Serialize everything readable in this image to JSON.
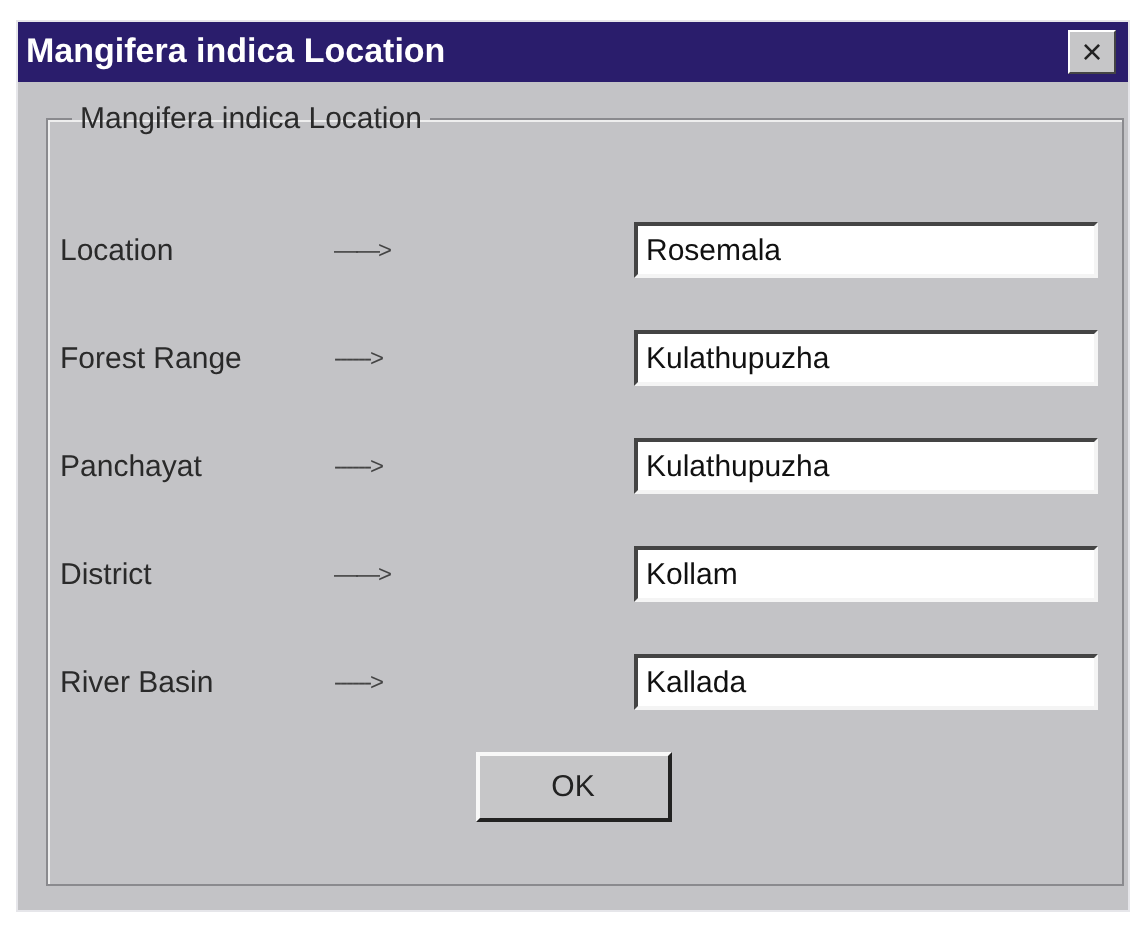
{
  "window": {
    "title": "Mangifera indica Location",
    "close": "×"
  },
  "group": {
    "title": "Mangifera indica Location"
  },
  "fields": [
    {
      "label": "Location",
      "arrow": "——>",
      "value": "Rosemala"
    },
    {
      "label": "Forest Range",
      "arrow": "------>",
      "value": "Kulathupuzha"
    },
    {
      "label": "Panchayat",
      "arrow": "------>",
      "value": "Kulathupuzha"
    },
    {
      "label": "District",
      "arrow": "——>",
      "value": "Kollam"
    },
    {
      "label": "River Basin",
      "arrow": "------>",
      "value": "Kallada"
    }
  ],
  "buttons": [
    "OK"
  ]
}
